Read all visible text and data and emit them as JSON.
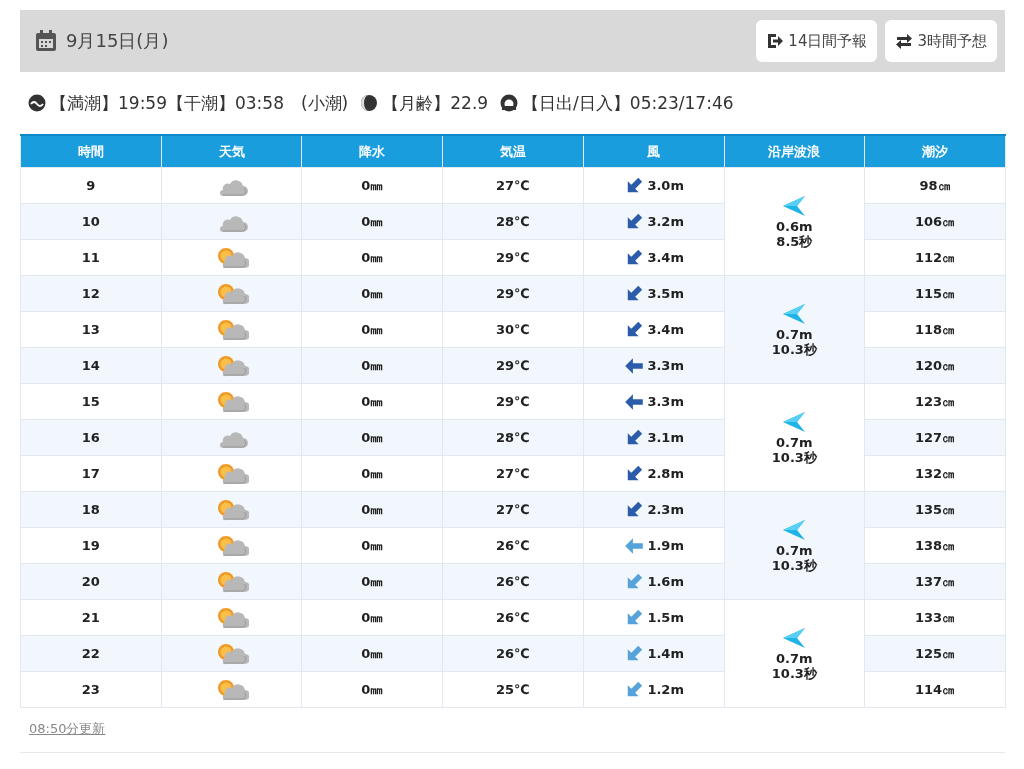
{
  "header": {
    "date": "9月15日(月)",
    "buttons": [
      {
        "kind": "exit",
        "label": "14日間予報"
      },
      {
        "kind": "swap",
        "label": "3時間予想"
      }
    ]
  },
  "info": [
    {
      "kind": "tide",
      "text": "【満潮】19:59【干潮】03:58　(小潮)"
    },
    {
      "kind": "moon",
      "text": "【月齢】22.9"
    },
    {
      "kind": "sun",
      "text": "【日出/日入】05:23/17:46"
    }
  ],
  "table": {
    "columns": [
      "時間",
      "天気",
      "降水",
      "気温",
      "風",
      "沿岸波浪",
      "潮汐"
    ],
    "rows": [
      {
        "hour": "9",
        "weather": {
          "kind": "cloudy"
        },
        "precip": "0㎜",
        "temp": "27℃",
        "wind": {
          "kind": "sw",
          "color": "#2b5cab",
          "speed": "3.0m"
        },
        "tide": "98㎝"
      },
      {
        "hour": "10",
        "weather": {
          "kind": "cloudy"
        },
        "precip": "0㎜",
        "temp": "28℃",
        "wind": {
          "kind": "sw",
          "color": "#2b5cab",
          "speed": "3.2m"
        },
        "tide": "106㎝"
      },
      {
        "hour": "11",
        "weather": {
          "kind": "partly_cloudy"
        },
        "precip": "0㎜",
        "temp": "29℃",
        "wind": {
          "kind": "sw",
          "color": "#2b5cab",
          "speed": "3.4m"
        },
        "tide": "112㎝"
      },
      {
        "hour": "12",
        "weather": {
          "kind": "partly_cloudy"
        },
        "precip": "0㎜",
        "temp": "29℃",
        "wind": {
          "kind": "sw",
          "color": "#2b5cab",
          "speed": "3.5m"
        },
        "tide": "115㎝"
      },
      {
        "hour": "13",
        "weather": {
          "kind": "partly_cloudy"
        },
        "precip": "0㎜",
        "temp": "30℃",
        "wind": {
          "kind": "sw",
          "color": "#2b5cab",
          "speed": "3.4m"
        },
        "tide": "118㎝"
      },
      {
        "hour": "14",
        "weather": {
          "kind": "partly_cloudy"
        },
        "precip": "0㎜",
        "temp": "29℃",
        "wind": {
          "kind": "w",
          "color": "#2b5cab",
          "speed": "3.3m"
        },
        "tide": "120㎝"
      },
      {
        "hour": "15",
        "weather": {
          "kind": "partly_cloudy"
        },
        "precip": "0㎜",
        "temp": "29℃",
        "wind": {
          "kind": "w",
          "color": "#2b5cab",
          "speed": "3.3m"
        },
        "tide": "123㎝"
      },
      {
        "hour": "16",
        "weather": {
          "kind": "cloudy"
        },
        "precip": "0㎜",
        "temp": "28℃",
        "wind": {
          "kind": "sw",
          "color": "#2b5cab",
          "speed": "3.1m"
        },
        "tide": "127㎝"
      },
      {
        "hour": "17",
        "weather": {
          "kind": "partly_cloudy"
        },
        "precip": "0㎜",
        "temp": "27℃",
        "wind": {
          "kind": "sw",
          "color": "#2b5cab",
          "speed": "2.8m"
        },
        "tide": "132㎝"
      },
      {
        "hour": "18",
        "weather": {
          "kind": "partly_cloudy"
        },
        "precip": "0㎜",
        "temp": "27℃",
        "wind": {
          "kind": "sw",
          "color": "#2b5cab",
          "speed": "2.3m"
        },
        "tide": "135㎝"
      },
      {
        "hour": "19",
        "weather": {
          "kind": "partly_cloudy"
        },
        "precip": "0㎜",
        "temp": "26℃",
        "wind": {
          "kind": "w",
          "color": "#55a3da",
          "speed": "1.9m"
        },
        "tide": "138㎝"
      },
      {
        "hour": "20",
        "weather": {
          "kind": "partly_cloudy"
        },
        "precip": "0㎜",
        "temp": "26℃",
        "wind": {
          "kind": "sw",
          "color": "#55a3da",
          "speed": "1.6m"
        },
        "tide": "137㎝"
      },
      {
        "hour": "21",
        "weather": {
          "kind": "partly_cloudy"
        },
        "precip": "0㎜",
        "temp": "26℃",
        "wind": {
          "kind": "sw",
          "color": "#55a3da",
          "speed": "1.5m"
        },
        "tide": "133㎝"
      },
      {
        "hour": "22",
        "weather": {
          "kind": "partly_cloudy"
        },
        "precip": "0㎜",
        "temp": "26℃",
        "wind": {
          "kind": "sw",
          "color": "#55a3da",
          "speed": "1.4m"
        },
        "tide": "125㎝"
      },
      {
        "hour": "23",
        "weather": {
          "kind": "partly_cloudy"
        },
        "precip": "0㎜",
        "temp": "25℃",
        "wind": {
          "kind": "sw",
          "color": "#55a3da",
          "speed": "1.2m"
        },
        "tide": "114㎝"
      }
    ],
    "waves": [
      {
        "kind": "w",
        "height": "0.6m",
        "period": "8.5秒"
      },
      {
        "kind": "w",
        "height": "0.7m",
        "period": "10.3秒"
      },
      {
        "kind": "w",
        "height": "0.7m",
        "period": "10.3秒"
      },
      {
        "kind": "w",
        "height": "0.7m",
        "period": "10.3秒"
      },
      {
        "kind": "w",
        "height": "0.7m",
        "period": "10.3秒"
      }
    ]
  },
  "updated": "08:50分更新"
}
